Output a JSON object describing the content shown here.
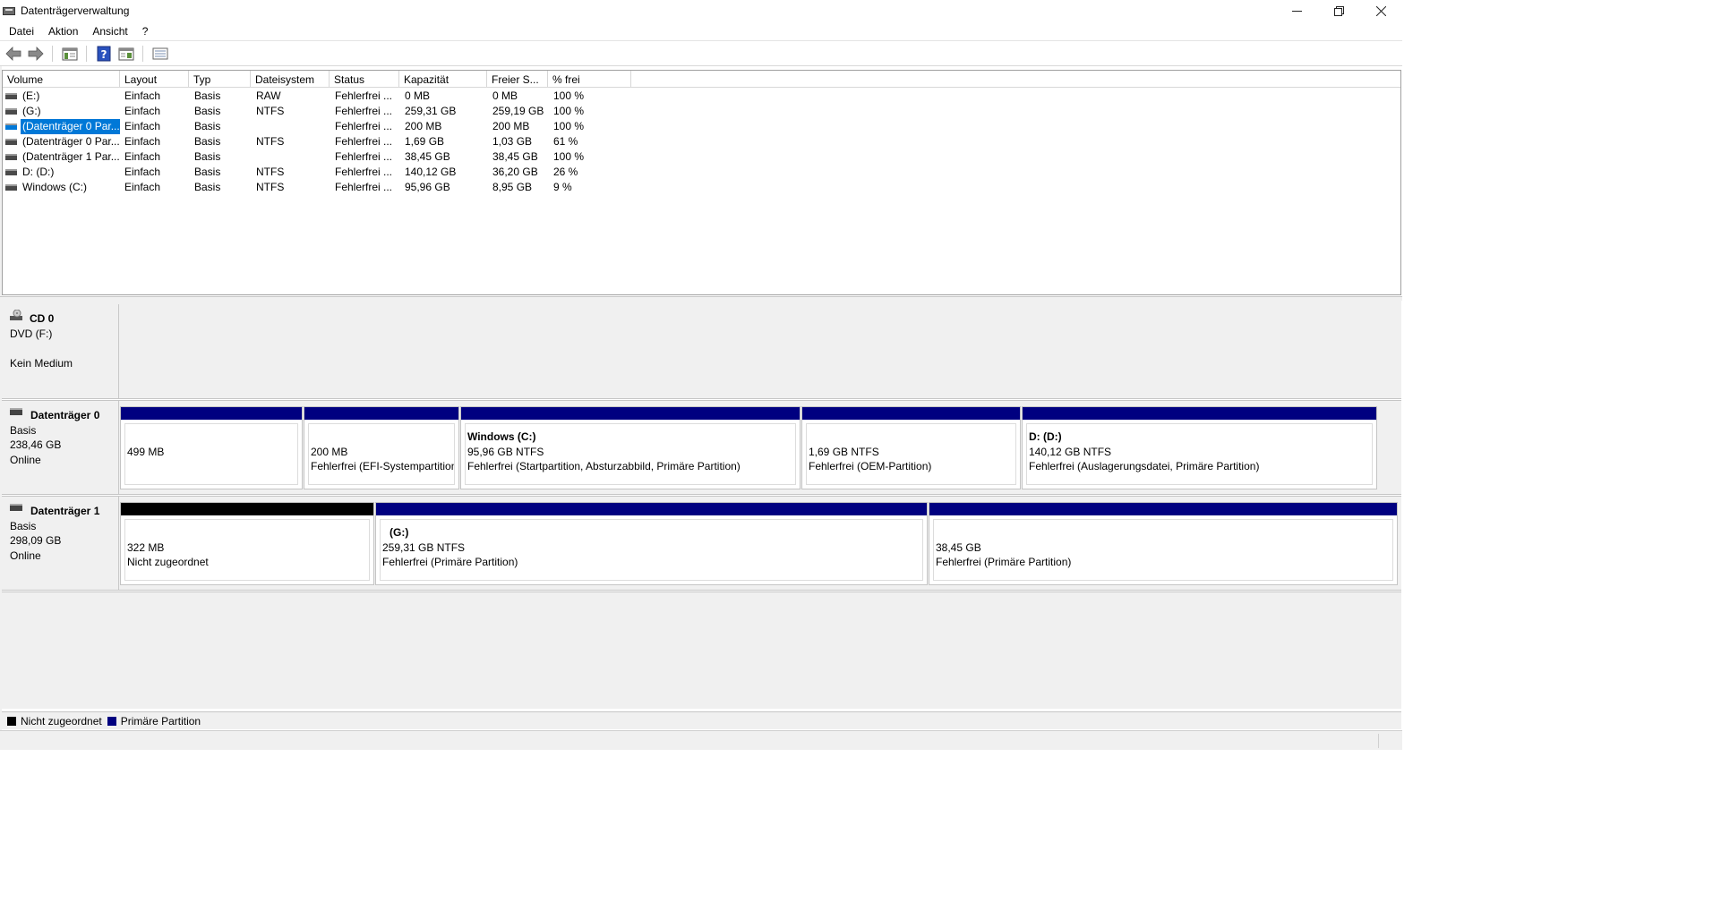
{
  "window": {
    "title": "Datenträgerverwaltung",
    "controls": {
      "minimize": "—",
      "restore": "❐",
      "close": "✕"
    }
  },
  "menu": [
    "Datei",
    "Aktion",
    "Ansicht",
    "?"
  ],
  "toolbar_icons": [
    "back-arrow-icon",
    "forward-arrow-icon",
    "console-tree-icon",
    "help-icon",
    "properties-icon",
    "list-view-icon"
  ],
  "volume_list": {
    "columns": [
      "Volume",
      "Layout",
      "Typ",
      "Dateisystem",
      "Status",
      "Kapazität",
      "Freier S...",
      "% frei"
    ],
    "rows": [
      {
        "volume": "(E:)",
        "layout": "Einfach",
        "type": "Basis",
        "fs": "RAW",
        "status": "Fehlerfrei ...",
        "capacity": "0 MB",
        "free": "0 MB",
        "pct": "100 %",
        "selected": false
      },
      {
        "volume": "(G:)",
        "layout": "Einfach",
        "type": "Basis",
        "fs": "NTFS",
        "status": "Fehlerfrei ...",
        "capacity": "259,31 GB",
        "free": "259,19 GB",
        "pct": "100 %",
        "selected": false
      },
      {
        "volume": "(Datenträger 0 Par...",
        "layout": "Einfach",
        "type": "Basis",
        "fs": "",
        "status": "Fehlerfrei ...",
        "capacity": "200 MB",
        "free": "200 MB",
        "pct": "100 %",
        "selected": true
      },
      {
        "volume": "(Datenträger 0 Par...",
        "layout": "Einfach",
        "type": "Basis",
        "fs": "NTFS",
        "status": "Fehlerfrei ...",
        "capacity": "1,69 GB",
        "free": "1,03 GB",
        "pct": "61 %",
        "selected": false
      },
      {
        "volume": "(Datenträger 1 Par...",
        "layout": "Einfach",
        "type": "Basis",
        "fs": "",
        "status": "Fehlerfrei ...",
        "capacity": "38,45 GB",
        "free": "38,45 GB",
        "pct": "100 %",
        "selected": false
      },
      {
        "volume": "D: (D:)",
        "layout": "Einfach",
        "type": "Basis",
        "fs": "NTFS",
        "status": "Fehlerfrei ...",
        "capacity": "140,12 GB",
        "free": "36,20 GB",
        "pct": "26 %",
        "selected": false
      },
      {
        "volume": "Windows (C:)",
        "layout": "Einfach",
        "type": "Basis",
        "fs": "NTFS",
        "status": "Fehlerfrei ...",
        "capacity": "95,96 GB",
        "free": "8,95 GB",
        "pct": "9 %",
        "selected": false
      }
    ]
  },
  "disks": {
    "cd0": {
      "name": "CD 0",
      "line1": "DVD (F:)",
      "line2": "",
      "line3": "Kein Medium"
    },
    "disk0": {
      "name": "Datenträger 0",
      "line1": "Basis",
      "line2": "238,46 GB",
      "line3": "Online",
      "partitions": [
        {
          "name": "",
          "size": "499 MB",
          "status": ""
        },
        {
          "name": "",
          "size": "200 MB",
          "status": "Fehlerfrei (EFI-Systempartition)"
        },
        {
          "name": "Windows  (C:)",
          "size": "95,96 GB NTFS",
          "status": "Fehlerfrei (Startpartition, Absturzabbild, Primäre Partition)"
        },
        {
          "name": "",
          "size": "1,69 GB NTFS",
          "status": "Fehlerfrei (OEM-Partition)"
        },
        {
          "name": "D:  (D:)",
          "size": "140,12 GB NTFS",
          "status": "Fehlerfrei (Auslagerungsdatei, Primäre Partition)"
        }
      ]
    },
    "disk1": {
      "name": "Datenträger 1",
      "line1": "Basis",
      "line2": "298,09 GB",
      "line3": "Online",
      "partitions": [
        {
          "name": "",
          "size": "322 MB",
          "status": "Nicht zugeordnet"
        },
        {
          "name": "(G:)",
          "size": "259,31 GB NTFS",
          "status": "Fehlerfrei (Primäre Partition)"
        },
        {
          "name": "",
          "size": "38,45 GB",
          "status": "Fehlerfrei (Primäre Partition)"
        }
      ]
    }
  },
  "legend": [
    {
      "label": "Nicht zugeordnet",
      "color": "#000000"
    },
    {
      "label": "Primäre Partition",
      "color": "#000080"
    }
  ],
  "colors": {
    "primary": "#000080",
    "unallocated": "#000000",
    "selection": "#0078d7"
  }
}
